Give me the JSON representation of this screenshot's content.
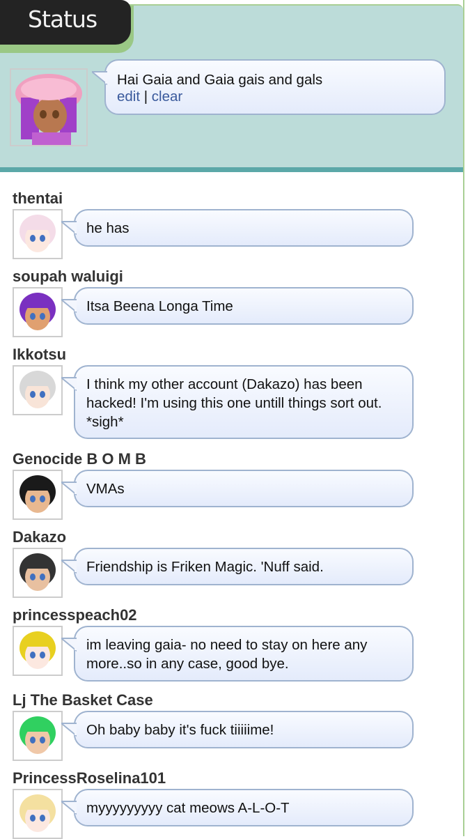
{
  "header": {
    "tab_label": "Status"
  },
  "my_status": {
    "text": "Hai Gaia and Gaia gais and gals",
    "edit_label": "edit",
    "separator": "|",
    "clear_label": "clear"
  },
  "feed": [
    {
      "username": "thentai",
      "message": "he has",
      "avatar": "white-pink-hair-avatar"
    },
    {
      "username": "soupah waluigi",
      "message": "Itsa Beena Longa Time",
      "avatar": "purple-cap-avatar"
    },
    {
      "username": "Ikkotsu",
      "message": "I think my other account (Dakazo) has been hacked! I'm using this one untill things sort out. *sigh*",
      "avatar": "silver-hair-avatar"
    },
    {
      "username": "Genocide B O M B",
      "message": "VMAs",
      "avatar": "black-hair-avatar"
    },
    {
      "username": "Dakazo",
      "message": "Friendship is Friken Magic. 'Nuff said.",
      "avatar": "ninja-avatar"
    },
    {
      "username": "princesspeach02",
      "message": "im leaving gaia- no need to stay on here any more..so in any case, good bye.",
      "avatar": "blonde-curly-avatar"
    },
    {
      "username": "Lj The Basket Case",
      "message": "Oh baby baby it's fuck tiiiiime!",
      "avatar": "green-hair-avatar"
    },
    {
      "username": "PrincessRoselina101",
      "message": "myyyyyyyyy cat meows A-L-O-T",
      "avatar": "blonde-avatar"
    }
  ]
}
